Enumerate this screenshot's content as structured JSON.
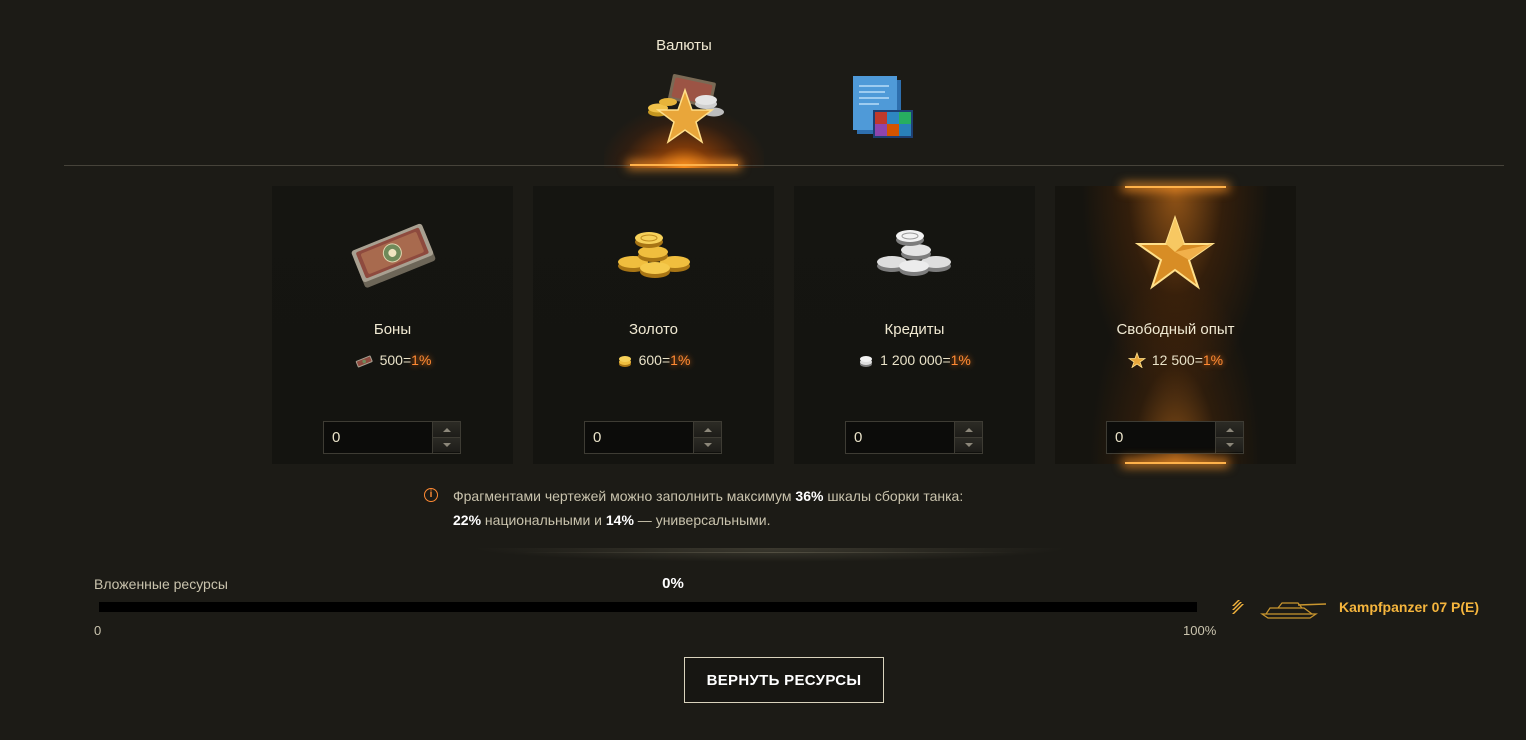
{
  "tabs": [
    {
      "label": "Валюты",
      "icon": "currencies-icon",
      "active": true
    },
    {
      "label": "",
      "icon": "blueprints-icon",
      "active": false
    }
  ],
  "cards": [
    {
      "title": "Боны",
      "icon": "bonds-icon",
      "rate_amount": "500",
      "rate_eq": "=",
      "rate_pct": "1%",
      "value": "0",
      "active": false
    },
    {
      "title": "Золото",
      "icon": "gold-icon",
      "rate_amount": "600",
      "rate_eq": "=",
      "rate_pct": "1%",
      "value": "0",
      "active": false
    },
    {
      "title": "Кредиты",
      "icon": "credits-icon",
      "rate_amount": "1 200 000",
      "rate_eq": "=",
      "rate_pct": "1%",
      "value": "0",
      "active": false
    },
    {
      "title": "Свободный опыт",
      "icon": "free-xp-icon",
      "rate_amount": "12 500",
      "rate_eq": "=",
      "rate_pct": "1%",
      "value": "0",
      "active": true
    }
  ],
  "note": {
    "line1_a": "Фрагментами чертежей можно заполнить максимум ",
    "line1_b": "36%",
    "line1_c": " шкалы сборки танка:",
    "line2_a": "22%",
    "line2_b": " национальными и ",
    "line2_c": "14%",
    "line2_d": " — универсальными."
  },
  "progress": {
    "label": "Вложенные ресурсы",
    "percent_text": "0%",
    "value": 0,
    "min_label": "0",
    "max_label": "100%"
  },
  "tank": {
    "name": "Kampfpanzer 07 P(E)",
    "tier_icon": "tier-icon",
    "tank_icon": "tank-icon"
  },
  "buttons": {
    "return_label": "ВЕРНУТЬ РЕСУРСЫ"
  },
  "colors": {
    "accent": "#ff8a33",
    "glow": "#ffb24a",
    "tank_name": "#f5b53d",
    "background": "#1c1b16"
  }
}
